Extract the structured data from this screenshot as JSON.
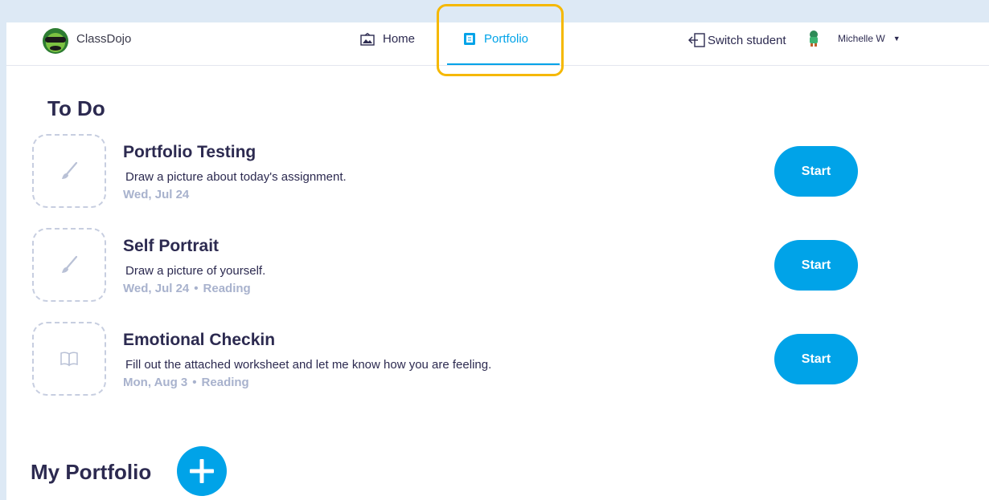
{
  "app": {
    "brand": "ClassDojo"
  },
  "nav": {
    "home_label": "Home",
    "portfolio_label": "Portfolio",
    "active_tab": "Portfolio"
  },
  "account": {
    "switch_label": "Switch student",
    "user_name": "Michelle W"
  },
  "todo": {
    "title": "To Do",
    "tasks": [
      {
        "title": "Portfolio Testing",
        "description": "Draw a picture about today's assignment.",
        "date": "Wed, Jul 24",
        "subject": "",
        "icon": "paintbrush-icon",
        "button_label": "Start"
      },
      {
        "title": "Self Portrait",
        "description": "Draw a picture of yourself.",
        "date": "Wed, Jul 24",
        "subject": "Reading",
        "icon": "paintbrush-icon",
        "button_label": "Start"
      },
      {
        "title": "Emotional Checkin",
        "description": "Fill out the attached worksheet and let me know how you are feeling.",
        "date": "Mon, Aug 3",
        "subject": "Reading",
        "icon": "book-icon",
        "button_label": "Start"
      }
    ]
  },
  "portfolio": {
    "title": "My Portfolio"
  },
  "colors": {
    "accent": "#00a3e8",
    "highlight": "#f5b800",
    "text": "#2c2a50",
    "muted": "#a8b2cd",
    "page_bg": "#dde9f5"
  }
}
